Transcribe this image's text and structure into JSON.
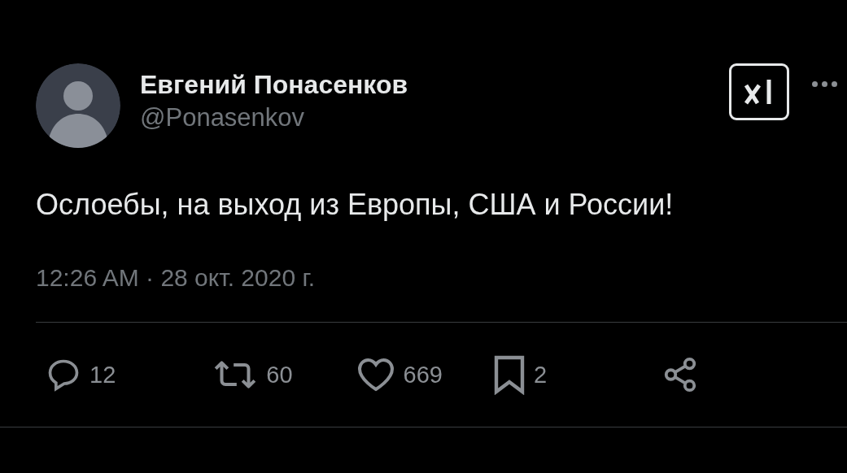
{
  "author": {
    "name": "Евгений Понасенков",
    "handle": "@Ponasenkov"
  },
  "tweet": {
    "text": "Ослоебы, на выход из Европы, США и России!",
    "timestamp": "12:26 AM · 28 окт. 2020 г."
  },
  "actions": [
    {
      "kind": "reply",
      "count": "12"
    },
    {
      "kind": "retweet",
      "count": "60"
    },
    {
      "kind": "like",
      "count": "669"
    },
    {
      "kind": "bookmark",
      "count": "2"
    },
    {
      "kind": "share"
    }
  ]
}
